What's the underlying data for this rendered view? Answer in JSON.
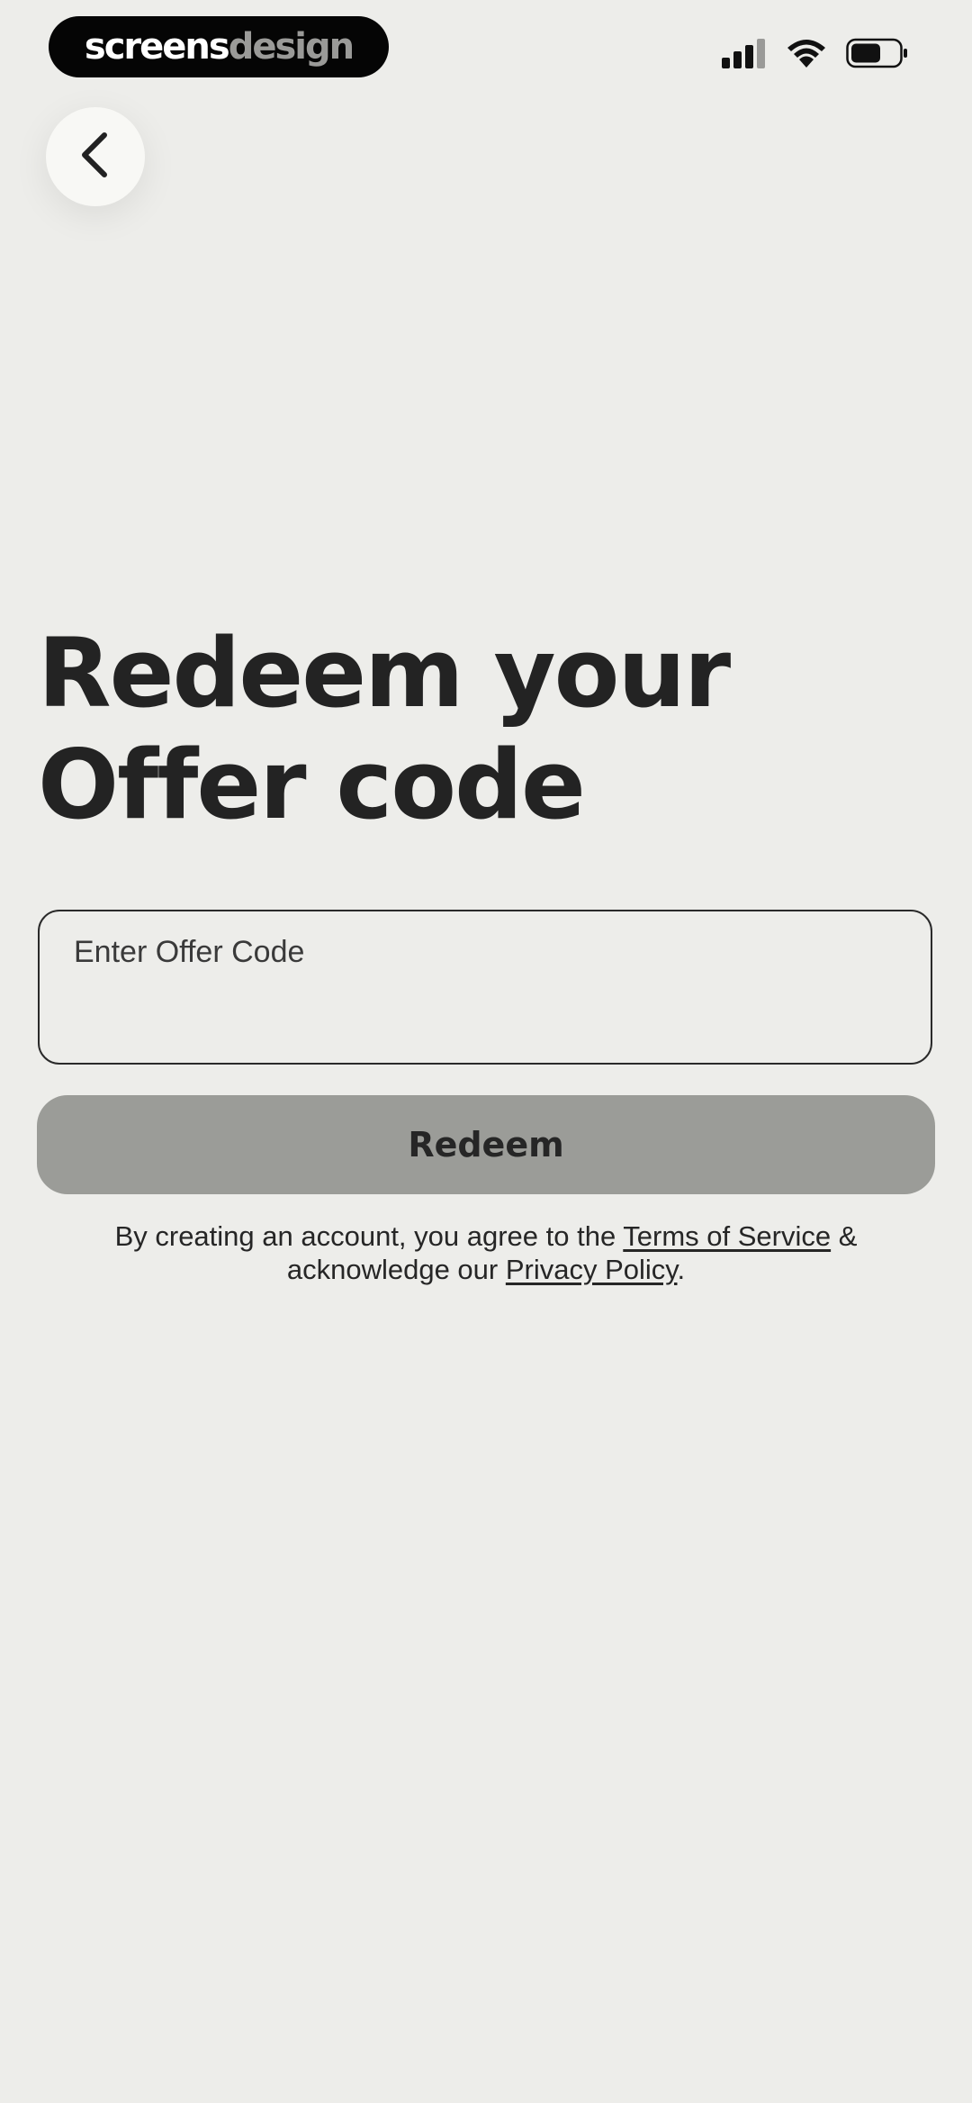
{
  "status_bar": {
    "brand_part1": "screens",
    "brand_part2": "design",
    "icons": [
      "signal-icon",
      "wifi-icon",
      "battery-icon"
    ]
  },
  "nav": {
    "back_icon": "chevron-left-icon"
  },
  "title": {
    "line1": "Redeem your",
    "line2": "Offer code"
  },
  "offer_field": {
    "placeholder": "Enter Offer Code",
    "value": ""
  },
  "redeem_button": {
    "label": "Redeem"
  },
  "legal": {
    "prefix": "By creating an account, you agree to the ",
    "terms_link": "Terms of Service",
    "middle": " & acknowledge our ",
    "privacy_link": "Privacy Policy",
    "suffix": "."
  },
  "colors": {
    "background": "#ededea",
    "text": "#232323",
    "button": "#9b9c98",
    "brand_pill": "#050505",
    "brand_accent": "#9a9a98"
  }
}
